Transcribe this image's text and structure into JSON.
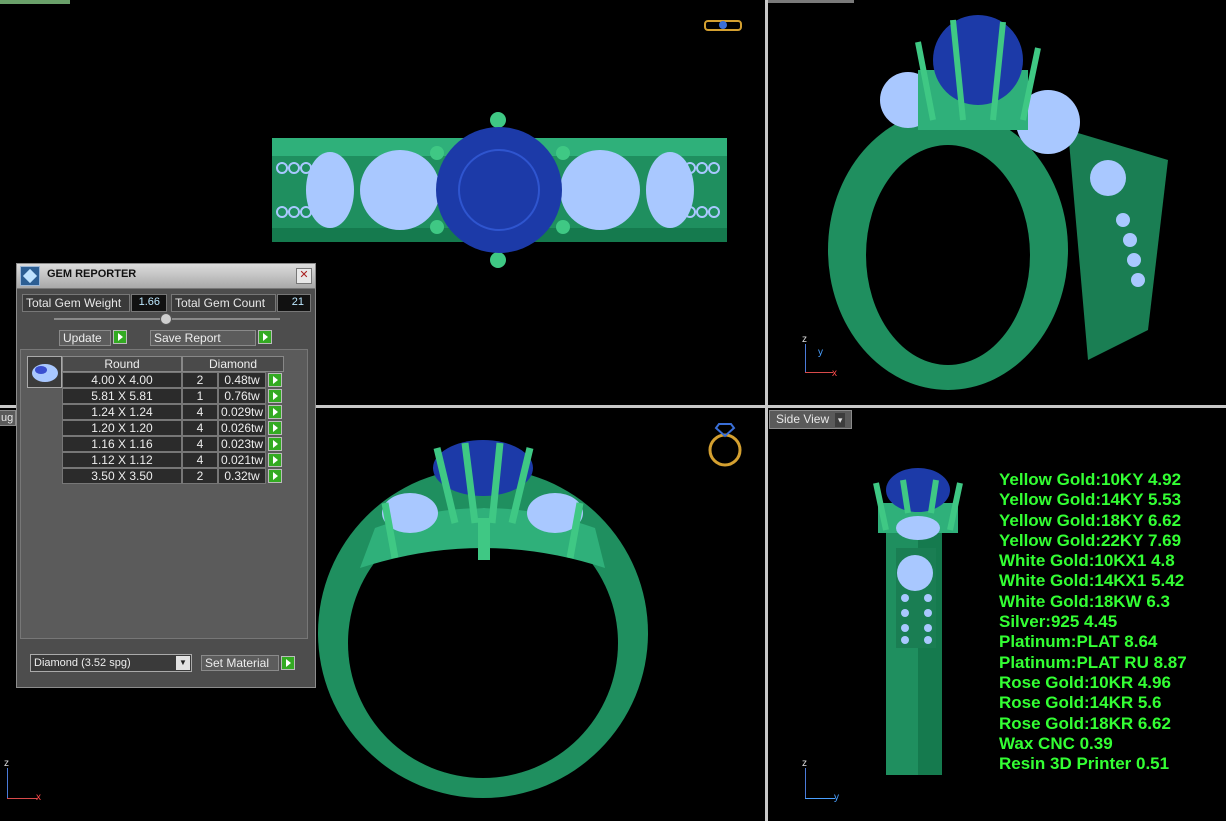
{
  "viewports": {
    "bottom_right_label": "Side View",
    "top_left_tab": "",
    "bottom_left_tab": "ug"
  },
  "axes": {
    "top_right": {
      "z": "z",
      "y": "y",
      "x": "x"
    },
    "bottom_left": {
      "z": "z",
      "x": "x"
    },
    "bottom_right": {
      "z": "z",
      "y": "y"
    }
  },
  "metal_weights": [
    "Yellow Gold:10KY 4.92",
    "Yellow Gold:14KY 5.53",
    "Yellow Gold:18KY 6.62",
    "Yellow Gold:22KY 7.69",
    "White Gold:10KX1 4.8",
    "White Gold:14KX1 5.42",
    "White Gold:18KW 6.3",
    "Silver:925 4.45",
    "Platinum:PLAT 8.64",
    "Platinum:PLAT RU 8.87",
    "Rose Gold:10KR 4.96",
    "Rose Gold:14KR 5.6",
    "Rose Gold:18KR 6.62",
    "Wax  CNC 0.39",
    "Resin 3D Printer 0.51"
  ],
  "gem_reporter": {
    "title": "GEM REPORTER",
    "close": "✕",
    "total_weight_label": "Total Gem Weight",
    "total_weight_value": "1.66",
    "total_count_label": "Total Gem Count",
    "total_count_value": "21",
    "update_label": "Update",
    "save_report_label": "Save Report",
    "shape_header": "Round",
    "material_header": "Diamond",
    "rows": [
      {
        "size": "4.00 X 4.00",
        "count": "2",
        "weight": "0.48tw"
      },
      {
        "size": "5.81 X 5.81",
        "count": "1",
        "weight": "0.76tw"
      },
      {
        "size": "1.24 X 1.24",
        "count": "4",
        "weight": "0.029tw"
      },
      {
        "size": "1.20 X 1.20",
        "count": "4",
        "weight": "0.026tw"
      },
      {
        "size": "1.16 X 1.16",
        "count": "4",
        "weight": "0.023tw"
      },
      {
        "size": "1.12 X 1.12",
        "count": "4",
        "weight": "0.021tw"
      },
      {
        "size": "3.50 X 3.50",
        "count": "2",
        "weight": "0.32tw"
      }
    ],
    "material_select": "Diamond     (3.52 spg)",
    "set_material_label": "Set Material"
  },
  "colors": {
    "metal": "#1f8f5f",
    "metal_light": "#3fc884",
    "sapphire": "#1c3aa8",
    "diamond": "#a9c8ff",
    "weights_text": "#33ff33"
  },
  "icons": {
    "view_cube_tl": "ring-top-icon",
    "view_cube_bl": "ring-front-icon",
    "gem_thumb": "round-gem-icon"
  }
}
